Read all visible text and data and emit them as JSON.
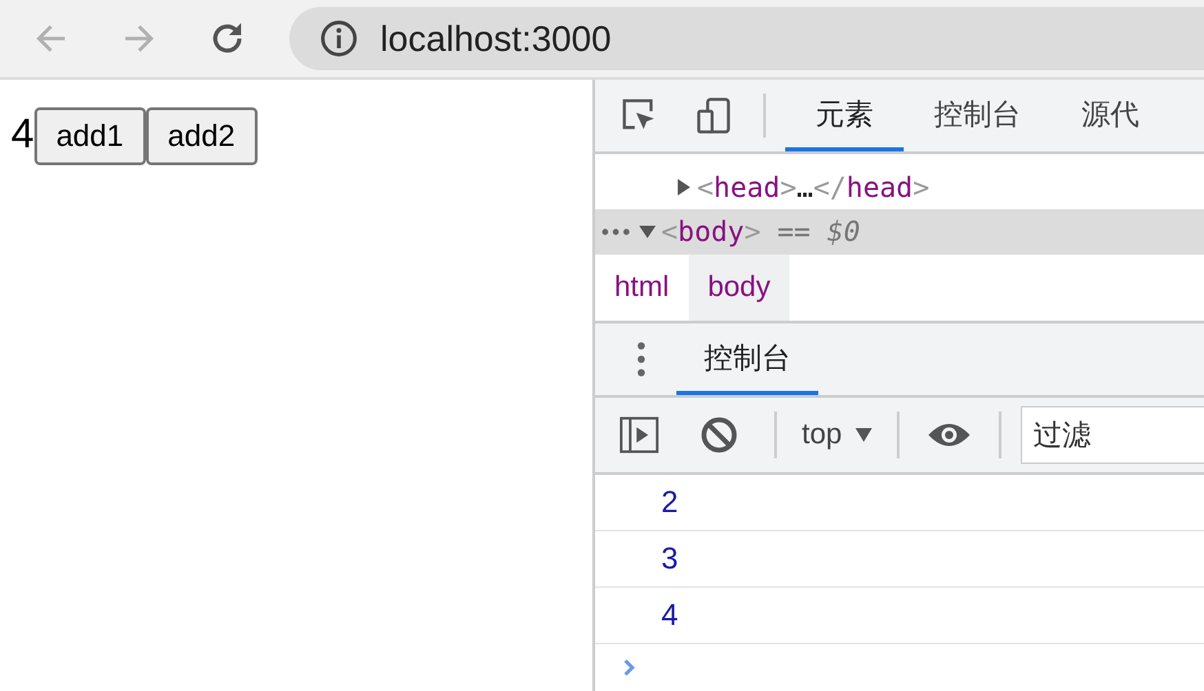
{
  "browser": {
    "url": "localhost:3000"
  },
  "page": {
    "count": "4",
    "buttons": [
      "add1",
      "add2"
    ]
  },
  "devtools": {
    "tabs": [
      {
        "label": "元素",
        "selected": true
      },
      {
        "label": "控制台",
        "selected": false
      },
      {
        "label": "源代",
        "selected": false
      }
    ],
    "nodes": [
      {
        "expanded": false,
        "selected": false,
        "parts": [
          {
            "kind": "bracket",
            "text": "<"
          },
          {
            "kind": "name",
            "text": "head"
          },
          {
            "kind": "bracket",
            "text": ">"
          },
          {
            "kind": "plain",
            "text": "…"
          },
          {
            "kind": "bracket",
            "text": "</"
          },
          {
            "kind": "name",
            "text": "head"
          },
          {
            "kind": "bracket",
            "text": ">"
          }
        ]
      },
      {
        "expanded": true,
        "selected": true,
        "parts": [
          {
            "kind": "bracket",
            "text": "<"
          },
          {
            "kind": "name",
            "text": "body"
          },
          {
            "kind": "bracket",
            "text": ">"
          },
          {
            "kind": "eq",
            "text": "=="
          },
          {
            "kind": "ref",
            "text": "$0"
          }
        ]
      }
    ],
    "breadcrumbs": [
      {
        "label": "html",
        "selected": false
      },
      {
        "label": "body",
        "selected": true
      }
    ],
    "drawer_tabs": [
      {
        "label": "控制台",
        "selected": true
      }
    ],
    "console": {
      "context": "top",
      "filter": {
        "placeholder": "过滤"
      },
      "messages": [
        "2",
        "3",
        "4"
      ]
    }
  }
}
